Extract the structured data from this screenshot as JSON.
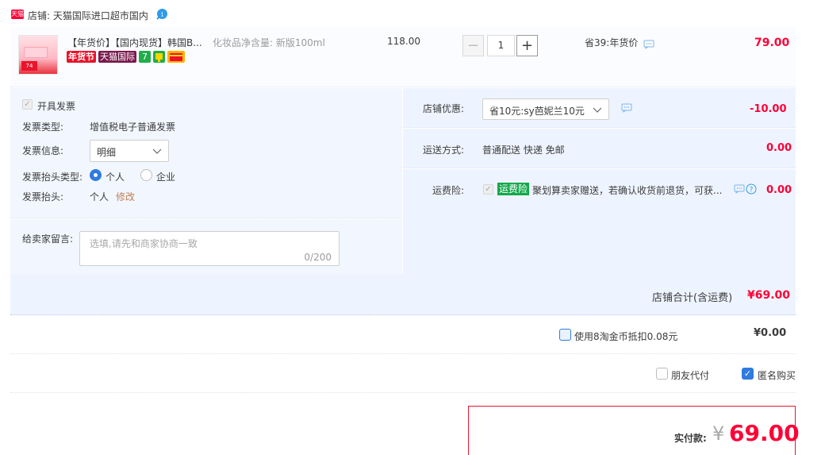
{
  "shop": {
    "badge": "天猫",
    "label": "店铺: 天猫国际进口超市国内",
    "ww_count": "1"
  },
  "item": {
    "title": "【年货价】【国内现货】韩国B...",
    "sku": "化妆品净含量: 新版100ml",
    "thumb_price": "74",
    "tags": [
      "年货节",
      "天猫国际"
    ],
    "price": "118.00",
    "qty_minus": "−",
    "quantity": "1",
    "qty_plus": "+",
    "promo": "省39:年货价",
    "subtotal": "79.00"
  },
  "invoice": {
    "enable_label": "开具发票",
    "type_label": "发票类型:",
    "type_value": "增值税电子普通发票",
    "info_label": "发票信息:",
    "info_value": "明细",
    "header_type_label": "发票抬头类型:",
    "opt_person": "个人",
    "opt_company": "企业",
    "header_label": "发票抬头:",
    "header_value": "个人",
    "edit_label": "修改"
  },
  "message": {
    "label": "给卖家留言:",
    "placeholder": "选填,请先和商家协商一致",
    "counter": "0/200"
  },
  "discount": {
    "label": "店铺优惠:",
    "value": "省10元:sy芭妮兰10元",
    "amount": "-10.00"
  },
  "shipping": {
    "label": "运送方式:",
    "value": "普通配送 快递 免邮",
    "amount": "0.00"
  },
  "insurance": {
    "label": "运费险:",
    "tag": "运费险",
    "text": "聚划算卖家赠送，若确认收货前退货，可获...",
    "amount": "0.00"
  },
  "shop_total": {
    "label": "店铺合计(含运费)",
    "value": "¥69.00"
  },
  "coins": {
    "label": "使用8淘金币抵扣0.08元",
    "value": "¥0.00"
  },
  "options": {
    "friend_pay": "朋友代付",
    "anonymous": "匿名购买"
  },
  "payment": {
    "label": "实付款:",
    "currency": "¥",
    "value": "69.00"
  },
  "colors": {
    "accent_red": "#ff0036",
    "link_blue": "#2f7bdf",
    "panel_bg": "#eef4ff"
  }
}
